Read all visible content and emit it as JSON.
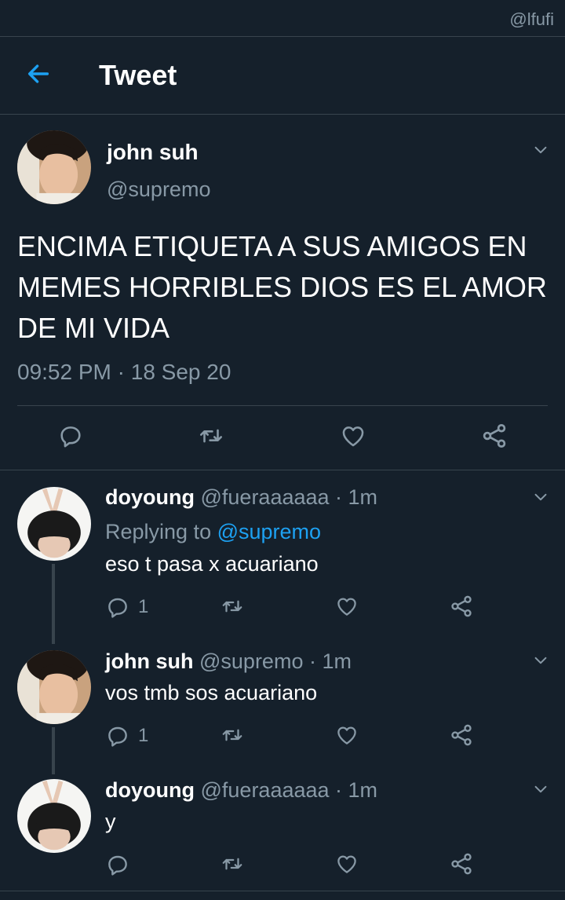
{
  "watermark": "@lfufi",
  "header": {
    "title": "Tweet"
  },
  "main_tweet": {
    "name": "john suh",
    "handle": "@supremo",
    "text": "ENCIMA ETIQUETA A SUS AMIGOS EN MEMES HORRIBLES DIOS ES EL AMOR DE MI VIDA",
    "time": "09:52 PM",
    "sep": "·",
    "date": "18 Sep 20"
  },
  "replies": [
    {
      "name": "doyoung",
      "handle": "@fueraaaaaa",
      "time": "· 1m",
      "replying_prefix": "Replying to ",
      "replying_to": "@supremo",
      "text": "eso t pasa x acuariano",
      "reply_count": "1"
    },
    {
      "name": "john suh",
      "handle": "@supremo",
      "time": "· 1m",
      "text": "vos tmb sos acuariano",
      "reply_count": "1"
    },
    {
      "name": "doyoung",
      "handle": "@fueraaaaaa",
      "time": "· 1m",
      "text": "y",
      "reply_count": ""
    }
  ],
  "colors": {
    "background": "#15202b",
    "accent": "#1da1f2",
    "muted": "#8899a6",
    "divider": "#38444d"
  },
  "icons": [
    "back-arrow-icon",
    "chevron-down-icon",
    "reply-icon",
    "retweet-icon",
    "like-icon",
    "share-icon"
  ]
}
